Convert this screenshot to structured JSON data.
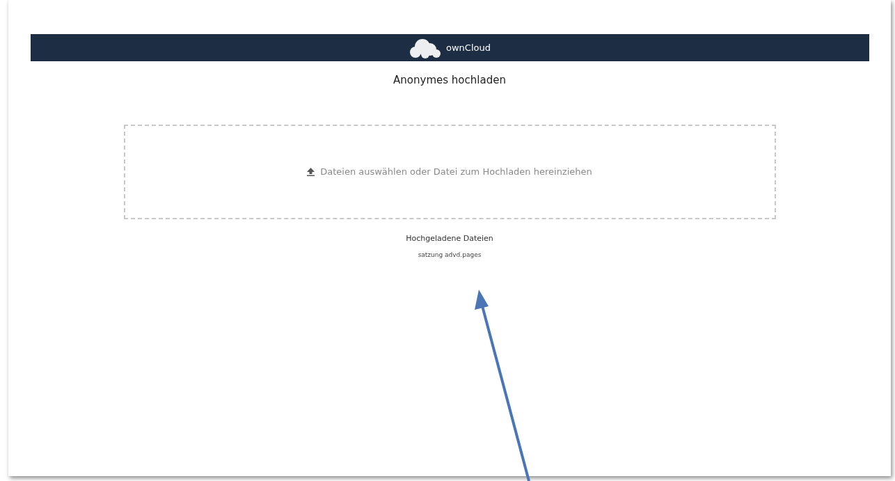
{
  "header": {
    "brand": "ownCloud"
  },
  "title": "Anonymes hochladen",
  "dropzone": {
    "label": "Dateien auswählen oder Datei zum Hochladen hereinziehen"
  },
  "uploaded": {
    "heading": "Hochgeladene Dateien",
    "files": [
      "satzung advd.pages"
    ]
  }
}
